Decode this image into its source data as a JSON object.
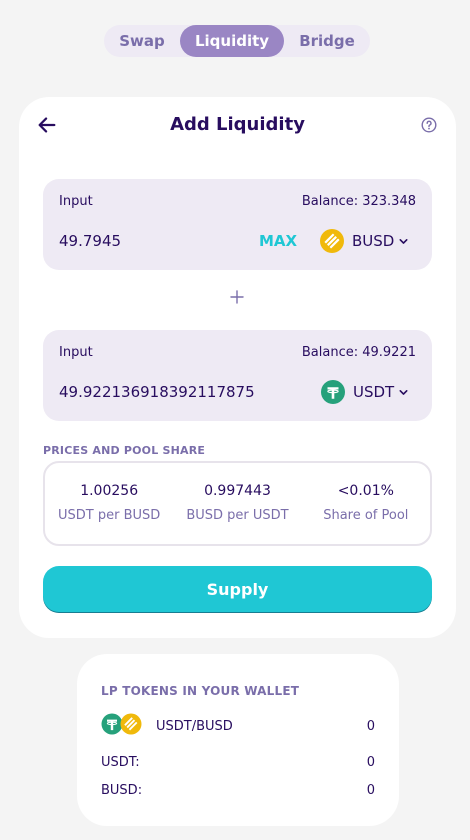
{
  "topnav": {
    "tabs": [
      "Swap",
      "Liquidity",
      "Bridge"
    ],
    "active": "Liquidity"
  },
  "card": {
    "title": "Add Liquidity"
  },
  "input_a": {
    "label": "Input",
    "balance": "Balance: 323.348",
    "amount": "49.7945",
    "max_label": "MAX",
    "token": "BUSD",
    "token_icon": "busd-icon"
  },
  "input_b": {
    "label": "Input",
    "balance": "Balance: 49.9221",
    "amount": "49.922136918392117875",
    "token": "USDT",
    "token_icon": "usdt-icon"
  },
  "prices": {
    "heading": "PRICES AND POOL SHARE",
    "items": [
      {
        "value": "1.00256",
        "label": "USDT per BUSD"
      },
      {
        "value": "0.997443",
        "label": "BUSD per USDT"
      },
      {
        "value": "<0.01%",
        "label": "Share of Pool"
      }
    ]
  },
  "supply_label": "Supply",
  "lp": {
    "title": "LP TOKENS IN YOUR WALLET",
    "pair": "USDT/BUSD",
    "pair_value": "0",
    "rows": [
      {
        "label": "USDT:",
        "value": "0"
      },
      {
        "label": "BUSD:",
        "value": "0"
      }
    ]
  },
  "colors": {
    "primary": "#1fc7d4",
    "text": "#280d5f",
    "secondary_text": "#7a6eaa",
    "input_bg": "#eeeaf4",
    "active_tab": "#9a86c4",
    "busd": "#f0b90b",
    "usdt": "#26a17b"
  }
}
